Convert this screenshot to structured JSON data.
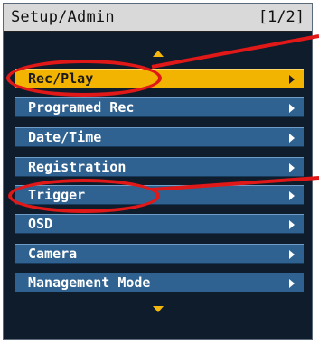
{
  "header": {
    "title": "Setup/Admin",
    "page": "[1/2]"
  },
  "menu": {
    "items": [
      {
        "label": "Rec/Play",
        "selected": true
      },
      {
        "label": "Programed Rec",
        "selected": false
      },
      {
        "label": "Date/Time",
        "selected": false
      },
      {
        "label": "Registration",
        "selected": false
      },
      {
        "label": "Trigger",
        "selected": false
      },
      {
        "label": "OSD",
        "selected": false
      },
      {
        "label": "Camera",
        "selected": false
      },
      {
        "label": "Management Mode",
        "selected": false
      }
    ]
  },
  "colors": {
    "highlight": "#f2b400",
    "item": "#2f6290",
    "background": "#0e1c2c",
    "annotation": "#e01818"
  },
  "icons": [
    "scroll-up-arrow-icon",
    "submenu-arrow-icon",
    "scroll-down-arrow-icon"
  ]
}
